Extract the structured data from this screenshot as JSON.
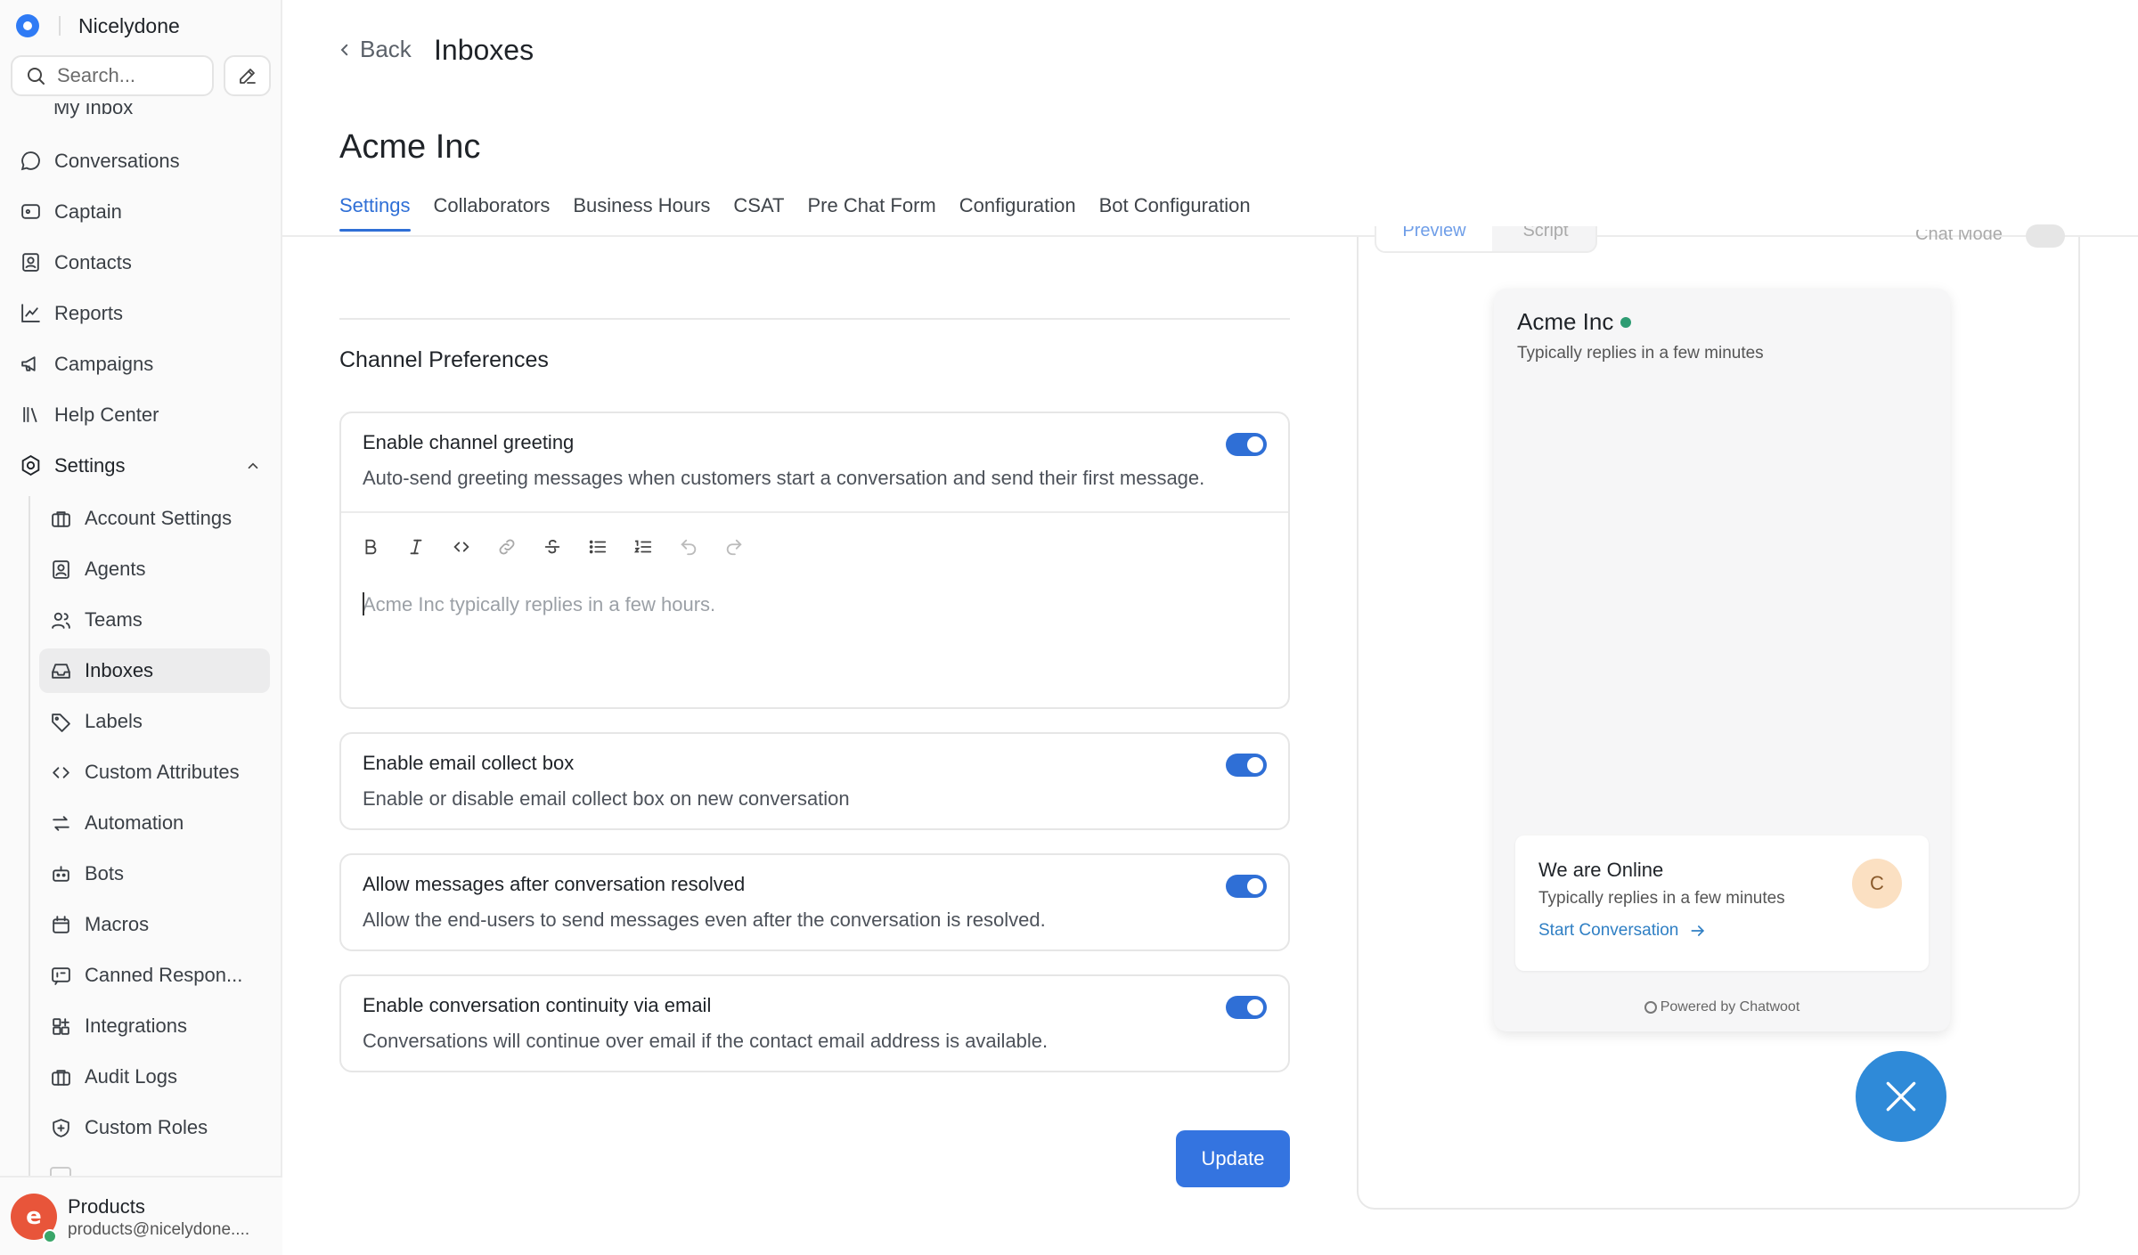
{
  "app": {
    "brand_name": "Nicelydone",
    "search_placeholder": "Search..."
  },
  "nav": {
    "cut_label": "My Inbox",
    "conversations": "Conversations",
    "captain": "Captain",
    "contacts": "Contacts",
    "reports": "Reports",
    "campaigns": "Campaigns",
    "help_center": "Help Center",
    "settings": "Settings"
  },
  "settings_menu": [
    {
      "label": "Account Settings",
      "icon": "briefcase-icon"
    },
    {
      "label": "Agents",
      "icon": "user-square-icon"
    },
    {
      "label": "Teams",
      "icon": "users-icon"
    },
    {
      "label": "Inboxes",
      "icon": "inbox-icon",
      "active": true
    },
    {
      "label": "Labels",
      "icon": "tag-icon"
    },
    {
      "label": "Custom Attributes",
      "icon": "code-icon"
    },
    {
      "label": "Automation",
      "icon": "arrows-icon"
    },
    {
      "label": "Bots",
      "icon": "bot-icon"
    },
    {
      "label": "Macros",
      "icon": "calendar-icon"
    },
    {
      "label": "Canned Respon...",
      "icon": "message-square-icon"
    },
    {
      "label": "Integrations",
      "icon": "grid-plus-icon"
    },
    {
      "label": "Audit Logs",
      "icon": "briefcase-icon"
    },
    {
      "label": "Custom Roles",
      "icon": "shield-icon"
    }
  ],
  "user": {
    "name": "Products",
    "email": "products@nicelydone...."
  },
  "header": {
    "back_label": "Back",
    "title": "Inboxes"
  },
  "inbox": {
    "name": "Acme Inc"
  },
  "tabs": [
    {
      "label": "Settings",
      "active": true
    },
    {
      "label": "Collaborators"
    },
    {
      "label": "Business Hours"
    },
    {
      "label": "CSAT"
    },
    {
      "label": "Pre Chat Form"
    },
    {
      "label": "Configuration"
    },
    {
      "label": "Bot Configuration"
    }
  ],
  "channel_preferences": {
    "title": "Channel Preferences",
    "greeting": {
      "title": "Enable channel greeting",
      "description": "Auto-send greeting messages when customers start a conversation and send their first message.",
      "enabled": true,
      "editor_placeholder": "Acme Inc typically replies in a few hours."
    },
    "email_collect": {
      "title": "Enable email collect box",
      "description": "Enable or disable email collect box on new conversation",
      "enabled": true
    },
    "allow_after_resolved": {
      "title": "Allow messages after conversation resolved",
      "description": "Allow the end-users to send messages even after the conversation is resolved.",
      "enabled": true
    },
    "continuity_email": {
      "title": "Enable conversation continuity via email",
      "description": "Conversations will continue over email if the contact email address is available.",
      "enabled": true
    }
  },
  "update_label": "Update",
  "preview": {
    "tab_preview": "Preview",
    "tab_script": "Script",
    "mode_label": "Chat Mode",
    "widget_title": "Acme Inc",
    "widget_subtitle": "Typically replies in a few minutes",
    "card_title": "We are Online",
    "card_subtitle": "Typically replies in a few minutes",
    "card_link": "Start Conversation",
    "card_avatar": "C",
    "powered_by": "Powered by Chatwoot"
  },
  "colors": {
    "accent": "#2f6fd6",
    "online": "#2e9c73",
    "fab": "#2f8ad8"
  }
}
